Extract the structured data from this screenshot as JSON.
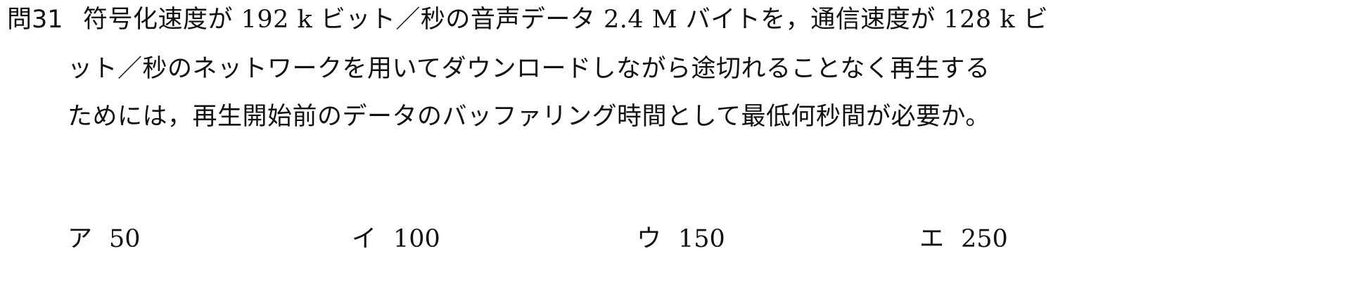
{
  "question": {
    "number": "問31",
    "lines": [
      "符号化速度が 192 k ビット／秒の音声データ 2.4 M バイトを，通信速度が 128 k ビ",
      "ット／秒のネットワークを用いてダウンロードしながら途切れることなく再生する",
      "ためには，再生開始前のデータのバッファリング時間として最低何秒間が必要か。"
    ]
  },
  "choices": [
    {
      "mark": "ア",
      "value": "50"
    },
    {
      "mark": "イ",
      "value": "100"
    },
    {
      "mark": "ウ",
      "value": "150"
    },
    {
      "mark": "エ",
      "value": "250"
    }
  ]
}
